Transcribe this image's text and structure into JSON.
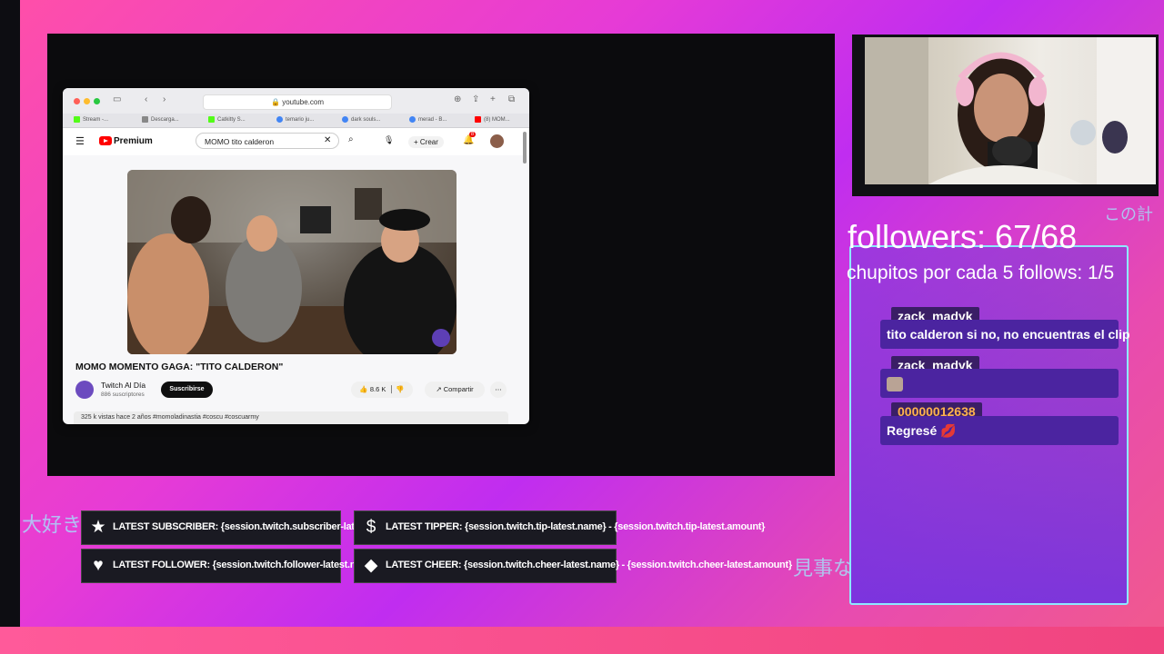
{
  "browser": {
    "url": "youtube.com",
    "tabs": [
      "Stream -...",
      "Descarga...",
      "Catkitty S...",
      "temario ju...",
      "dark souls...",
      "merad - B...",
      "(8) MOM..."
    ],
    "youtube": {
      "logo": "Premium",
      "search_value": "MOMO tito calderon",
      "create_label": "Crear",
      "notification_count": "8",
      "video_title": "MOMO MOMENTO GAGA: \"TITO CALDERON\"",
      "channel_name": "Twitch Al Día",
      "channel_subs": "886 suscriptores",
      "subscribe_label": "Suscribirse",
      "likes": "8.6 K",
      "share_label": "Compartir",
      "description": "325 k vistas  hace 2 años  #momoladinastia #coscu #coscuarmy"
    }
  },
  "overlay": {
    "followers": "followers: 67/68",
    "chupitos": "chupitos por cada 5 follows: 1/5",
    "jp_left": "大好き",
    "jp_right": "見事な",
    "jp_top": "この計"
  },
  "chat": [
    {
      "user": "zack_madyk",
      "message": "tito calderon si no, no encuentras el clip",
      "user_color": "#ffffff"
    },
    {
      "user": "zack_madyk",
      "message": "",
      "user_color": "#ffffff"
    },
    {
      "user": "00000012638",
      "message": "Regresé 💋",
      "user_color": "#ffb24d"
    }
  ],
  "labels": {
    "subscriber": "LATEST SUBSCRIBER: {session.twitch.subscriber-latest.name}",
    "tipper": "LATEST TIPPER: {session.twitch.tip-latest.name} -  {session.twitch.tip-latest.amount}",
    "follower": "LATEST FOLLOWER: {session.twitch.follower-latest.name}",
    "cheer": "LATEST CHEER: {session.twitch.cheer-latest.name} - {session.twitch.cheer-latest.amount}"
  },
  "icons": {
    "subscriber": "star-icon",
    "tipper": "dollar-icon",
    "follower": "heart-icon",
    "cheer": "diamond-icon"
  }
}
